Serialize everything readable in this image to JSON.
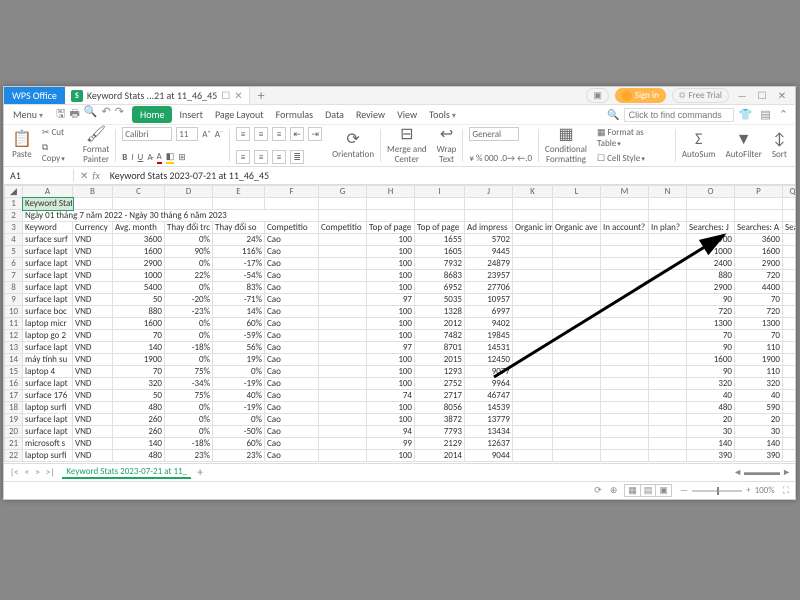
{
  "app": {
    "name": "WPS Office"
  },
  "file_tab": {
    "label": "Keyword Stats ...21 at 11_46_45"
  },
  "titlebar_buttons": {
    "signin": "Sign in",
    "free_trial": "Free Trial"
  },
  "menu": {
    "menu": "Menu",
    "home": "Home",
    "insert": "Insert",
    "page_layout": "Page Layout",
    "formulas": "Formulas",
    "data": "Data",
    "review": "Review",
    "view": "View",
    "tools": "Tools",
    "search_placeholder": "Click to find commands"
  },
  "ribbon": {
    "paste": "Paste",
    "cut": "Cut",
    "copy": "Copy",
    "format_painter": "Format\nPainter",
    "font_name": "Calibri",
    "font_size": "11",
    "general": "General",
    "orientation": "Orientation",
    "merge": "Merge and\nCenter",
    "wrap": "Wrap\nText",
    "cond": "Conditional\nFormatting",
    "format_table": "Format as Table",
    "cell_style": "Cell Style",
    "autosum": "AutoSum",
    "autofilter": "AutoFilter",
    "sort": "Sort"
  },
  "cell_ref": "A1",
  "formula": "Keyword Stats 2023-07-21 at 11_46_45",
  "columns": [
    "A",
    "B",
    "C",
    "D",
    "E",
    "F",
    "G",
    "H",
    "I",
    "J",
    "K",
    "L",
    "M",
    "N",
    "O",
    "P"
  ],
  "title_cell": "Keyword Stats 2023-07-21 at 11_46_45",
  "date_range": "Ngày 01 tháng 7 năm 2022 - Ngày 30 tháng 6 năm 2023",
  "headers": {
    "a": "Keyword",
    "b": "Currency",
    "c": "Avg. month",
    "d": "Thay đổi trc",
    "e": "Thay đổi so",
    "f": "Competitio",
    "g": "Competitio",
    "h": "Top of page",
    "i": "Top of page",
    "j": "Ad impress",
    "k": "Organic im",
    "l": "Organic ave",
    "m": "In account?",
    "n": "In plan?",
    "o": "Searches: J",
    "p": "Searches: A"
  },
  "rows": [
    {
      "a": "surface surf",
      "b": "VND",
      "c": "3600",
      "d": "0%",
      "e": "24%",
      "f": "Cao",
      "g": "",
      "h": "100",
      "i": "1655",
      "j": "5702",
      "o": "2900",
      "p": "3600"
    },
    {
      "a": "surface lapt",
      "b": "VND",
      "c": "1600",
      "d": "90%",
      "e": "116%",
      "f": "Cao",
      "g": "",
      "h": "100",
      "i": "1605",
      "j": "9445",
      "o": "1000",
      "p": "1600"
    },
    {
      "a": "surface lapt",
      "b": "VND",
      "c": "2900",
      "d": "0%",
      "e": "-17%",
      "f": "Cao",
      "g": "",
      "h": "100",
      "i": "7932",
      "j": "24879",
      "o": "2400",
      "p": "2900"
    },
    {
      "a": "surface lapt",
      "b": "VND",
      "c": "1000",
      "d": "22%",
      "e": "-54%",
      "f": "Cao",
      "g": "",
      "h": "100",
      "i": "8683",
      "j": "23957",
      "o": "880",
      "p": "720"
    },
    {
      "a": "surface lapt",
      "b": "VND",
      "c": "5400",
      "d": "0%",
      "e": "83%",
      "f": "Cao",
      "g": "",
      "h": "100",
      "i": "6952",
      "j": "27706",
      "o": "2900",
      "p": "4400"
    },
    {
      "a": "surface lapt",
      "b": "VND",
      "c": "50",
      "d": "-20%",
      "e": "-71%",
      "f": "Cao",
      "g": "",
      "h": "97",
      "i": "5035",
      "j": "10957",
      "o": "90",
      "p": "70"
    },
    {
      "a": "surface boc",
      "b": "VND",
      "c": "880",
      "d": "-23%",
      "e": "14%",
      "f": "Cao",
      "g": "",
      "h": "100",
      "i": "1328",
      "j": "6997",
      "o": "720",
      "p": "720"
    },
    {
      "a": "laptop micr",
      "b": "VND",
      "c": "1600",
      "d": "0%",
      "e": "60%",
      "f": "Cao",
      "g": "",
      "h": "100",
      "i": "2012",
      "j": "9402",
      "o": "1300",
      "p": "1300"
    },
    {
      "a": "laptop go 2",
      "b": "VND",
      "c": "70",
      "d": "0%",
      "e": "-59%",
      "f": "Cao",
      "g": "",
      "h": "100",
      "i": "7482",
      "j": "19845",
      "o": "70",
      "p": "70"
    },
    {
      "a": "surface lapt",
      "b": "VND",
      "c": "140",
      "d": "-18%",
      "e": "56%",
      "f": "Cao",
      "g": "",
      "h": "97",
      "i": "8701",
      "j": "14531",
      "o": "90",
      "p": "110"
    },
    {
      "a": "máy tính su",
      "b": "VND",
      "c": "1900",
      "d": "0%",
      "e": "19%",
      "f": "Cao",
      "g": "",
      "h": "100",
      "i": "2015",
      "j": "12450",
      "o": "1600",
      "p": "1900"
    },
    {
      "a": "laptop 4",
      "b": "VND",
      "c": "70",
      "d": "75%",
      "e": "0%",
      "f": "Cao",
      "g": "",
      "h": "100",
      "i": "1293",
      "j": "9077",
      "o": "90",
      "p": "110"
    },
    {
      "a": "surface lapt",
      "b": "VND",
      "c": "320",
      "d": "-34%",
      "e": "-19%",
      "f": "Cao",
      "g": "",
      "h": "100",
      "i": "2752",
      "j": "9964",
      "o": "320",
      "p": "320"
    },
    {
      "a": "surface 176",
      "b": "VND",
      "c": "50",
      "d": "75%",
      "e": "40%",
      "f": "Cao",
      "g": "",
      "h": "74",
      "i": "2717",
      "j": "46747",
      "o": "40",
      "p": "40"
    },
    {
      "a": "laptop surfi",
      "b": "VND",
      "c": "480",
      "d": "0%",
      "e": "-19%",
      "f": "Cao",
      "g": "",
      "h": "100",
      "i": "8056",
      "j": "14539",
      "o": "480",
      "p": "590"
    },
    {
      "a": "surface lapt",
      "b": "VND",
      "c": "260",
      "d": "0%",
      "e": "0%",
      "f": "Cao",
      "g": "",
      "h": "100",
      "i": "3872",
      "j": "13779",
      "o": "20",
      "p": "20"
    },
    {
      "a": "surface lapt",
      "b": "VND",
      "c": "260",
      "d": "0%",
      "e": "-50%",
      "f": "Cao",
      "g": "",
      "h": "94",
      "i": "7793",
      "j": "13434",
      "o": "30",
      "p": "30"
    },
    {
      "a": "microsoft s",
      "b": "VND",
      "c": "140",
      "d": "-18%",
      "e": "60%",
      "f": "Cao",
      "g": "",
      "h": "99",
      "i": "2129",
      "j": "12637",
      "o": "140",
      "p": "140"
    },
    {
      "a": "laptop surfi",
      "b": "VND",
      "c": "480",
      "d": "23%",
      "e": "23%",
      "f": "Cao",
      "g": "",
      "h": "100",
      "i": "2014",
      "j": "9044",
      "o": "390",
      "p": "390"
    }
  ],
  "last_col_hdr": "Searc",
  "sheet_tab": "Keyword Stats 2023-07-21 at 11_",
  "zoom": "100%"
}
